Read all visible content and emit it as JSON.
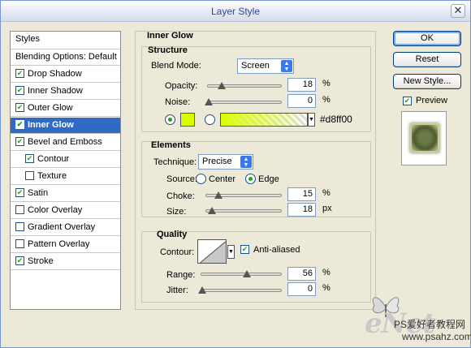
{
  "window": {
    "title": "Layer Style",
    "close_symbol": "✕"
  },
  "styles_list": {
    "items": [
      {
        "label": "Styles",
        "checkbox": false,
        "checked": false,
        "selected": false
      },
      {
        "label": "Blending Options: Default",
        "checkbox": false,
        "checked": false,
        "selected": false
      },
      {
        "label": "Drop Shadow",
        "checkbox": true,
        "checked": true,
        "selected": false
      },
      {
        "label": "Inner Shadow",
        "checkbox": true,
        "checked": true,
        "selected": false
      },
      {
        "label": "Outer Glow",
        "checkbox": true,
        "checked": true,
        "selected": false
      },
      {
        "label": "Inner Glow",
        "checkbox": true,
        "checked": true,
        "selected": true
      },
      {
        "label": "Bevel and Emboss",
        "checkbox": true,
        "checked": true,
        "selected": false
      },
      {
        "label": "Contour",
        "checkbox": true,
        "checked": true,
        "selected": false,
        "sub": true
      },
      {
        "label": "Texture",
        "checkbox": true,
        "checked": false,
        "selected": false,
        "sub": true
      },
      {
        "label": "Satin",
        "checkbox": true,
        "checked": true,
        "selected": false
      },
      {
        "label": "Color Overlay",
        "checkbox": true,
        "checked": false,
        "selected": false
      },
      {
        "label": "Gradient Overlay",
        "checkbox": true,
        "checked": false,
        "selected": false
      },
      {
        "label": "Pattern Overlay",
        "checkbox": true,
        "checked": false,
        "selected": false
      },
      {
        "label": "Stroke",
        "checkbox": true,
        "checked": true,
        "selected": false
      }
    ]
  },
  "inner_glow": {
    "title": "Inner Glow",
    "structure": {
      "title": "Structure",
      "blend_mode_label": "Blend Mode:",
      "blend_mode_value": "Screen",
      "opacity_label": "Opacity:",
      "opacity_value": "18",
      "opacity_percent": 18,
      "noise_label": "Noise:",
      "noise_value": "0",
      "noise_percent": 0,
      "percent_unit": "%",
      "solid_color": "#d8ff00",
      "gradient_hex_label": "#d8ff00"
    },
    "elements": {
      "title": "Elements",
      "technique_label": "Technique:",
      "technique_value": "Precise",
      "source_label": "Source:",
      "source_center": "Center",
      "source_edge": "Edge",
      "choke_label": "Choke:",
      "choke_value": "15",
      "choke_percent": 15,
      "size_label": "Size:",
      "size_value": "18",
      "size_fraction": 0.07,
      "percent_unit": "%",
      "px_unit": "px"
    },
    "quality": {
      "title": "Quality",
      "contour_label": "Contour:",
      "anti_aliased_label": "Anti-aliased",
      "range_label": "Range:",
      "range_value": "56",
      "range_percent": 56,
      "jitter_label": "Jitter:",
      "jitter_value": "0",
      "jitter_percent": 0,
      "percent_unit": "%"
    }
  },
  "buttons": {
    "ok": "OK",
    "reset": "Reset",
    "new_style": "New Style...",
    "preview_label": "Preview"
  },
  "watermark": {
    "logo": "eNet",
    "line1": "PS爱好者教程网",
    "line2": "www.psahz.com"
  },
  "icons": [
    "close-icon",
    "checkbox-icon",
    "dropdown-arrow-icon",
    "slider-thumb-icon",
    "butterfly-icon"
  ]
}
